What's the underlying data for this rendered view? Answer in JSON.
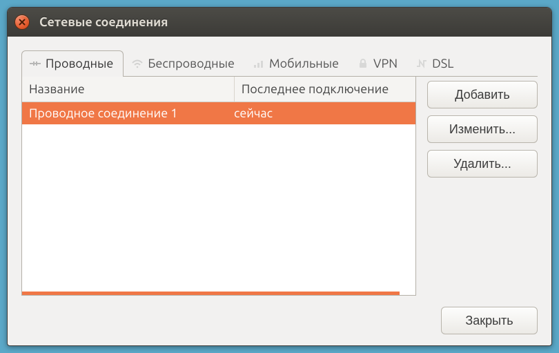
{
  "window": {
    "title": "Сетевые соединения"
  },
  "tabs": {
    "wired": {
      "label": "Проводные"
    },
    "wireless": {
      "label": "Беспроводные"
    },
    "mobile": {
      "label": "Мобильные"
    },
    "vpn": {
      "label": "VPN"
    },
    "dsl": {
      "label": "DSL"
    },
    "active": "wired"
  },
  "columns": {
    "name": "Название",
    "last": "Последнее подключение"
  },
  "connections": [
    {
      "name": "Проводное соединение 1",
      "last": "сейчас",
      "selected": true
    }
  ],
  "buttons": {
    "add": "Добавить",
    "edit": "Изменить...",
    "delete": "Удалить...",
    "close": "Закрыть"
  },
  "colors": {
    "accent": "#f07746"
  }
}
